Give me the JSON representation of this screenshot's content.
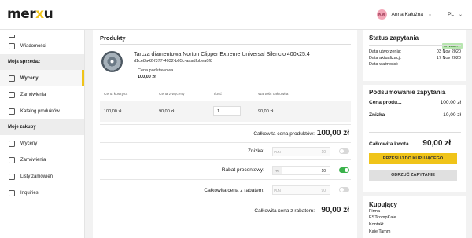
{
  "header": {
    "logo_main": "mer",
    "logo_accent": "x",
    "logo_end": "u",
    "user_initials": "KM",
    "user_name": "Anna Kałużna",
    "language": "PL"
  },
  "sidebar": {
    "items_top": [
      {
        "label": "Wiadomości"
      }
    ],
    "section_sales": "Moja sprzedaż",
    "sales_items": [
      {
        "label": "Wyceny",
        "active": true
      },
      {
        "label": "Zamówienia"
      },
      {
        "label": "Katalog produktów"
      }
    ],
    "section_buy": "Moje zakupy",
    "buy_items": [
      {
        "label": "Wyceny"
      },
      {
        "label": "Zamówienia"
      },
      {
        "label": "Listy zamówień"
      },
      {
        "label": "Inquiries"
      }
    ]
  },
  "products": {
    "title": "Produkty",
    "name": "Tarcza diamentowa Norton Clipper Extreme Universal Silencio 400x25.4",
    "id": "d1ce8a42-f377-4032-b05c-aaadfbbea0f8",
    "base_price_label": "Cena podstawowa",
    "base_price": "100,00 zł",
    "columns": [
      "Cena koszyka",
      "Cena z wyceny",
      "Ilość",
      "Wartość całkowita"
    ],
    "row": {
      "basket_price": "100,00 zł",
      "quote_price": "90,00 zł",
      "qty": "1",
      "total_value": "90,00 zł"
    },
    "totals": {
      "products_label": "Całkowita cena produktów:",
      "products_value": "100,00 zł",
      "discount_label": "Zniżka:",
      "discount_currency": "PLN",
      "discount_value": "10",
      "percent_label": "Rabat procentowy:",
      "percent_currency": "%",
      "percent_value": "10",
      "after_label": "Całkowita cena z rabatem:",
      "after_currency": "PLN",
      "after_value": "90",
      "final_label": "Całkowita cena z rabatem:",
      "final_value": "90,00 zł"
    }
  },
  "status": {
    "title": "Status zapytania",
    "badge": "OTWARTY",
    "rows": [
      {
        "k": "Data utworzenia:",
        "v": "03 Nov 2020"
      },
      {
        "k": "Data aktualizacji:",
        "v": "17 Nov 2020"
      },
      {
        "k": "Data ważności:",
        "v": ""
      }
    ]
  },
  "summary": {
    "title": "Podsumowanie zapytania",
    "rows": [
      {
        "k": "Cena produ...",
        "v": "100,00 zł"
      },
      {
        "k": "Zniżka",
        "v": "10,00 zł"
      }
    ],
    "total_label": "Całkowita kwota",
    "total_value": "90,00 zł",
    "send_button": "PRZEŚLIJ DO KUPUJĄCEGO",
    "reject_button": "ODRZUĆ ZAPYTANIE"
  },
  "buyers": {
    "title": "Kupujący",
    "lines": [
      "Firma",
      "ESTcompKaie",
      "Kontakt",
      "Kaie Tamm"
    ]
  }
}
